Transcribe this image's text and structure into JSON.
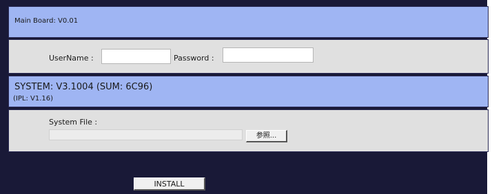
{
  "main_board": {
    "label": "Main Board: V0.01"
  },
  "login": {
    "username_label": "UserName :",
    "username_value": "",
    "password_label": "Password :",
    "password_value": ""
  },
  "system": {
    "version_line": "SYSTEM: V3.1004 (SUM: 6C96)",
    "ipl_line": "(IPL: V1.16)"
  },
  "upload": {
    "file_label": "System File :",
    "browse_label": "参照..."
  },
  "actions": {
    "install_label": "INSTALL"
  },
  "colors": {
    "background": "#191937",
    "header_band": "#9fb5f3",
    "form_band": "#e0e0e0"
  }
}
